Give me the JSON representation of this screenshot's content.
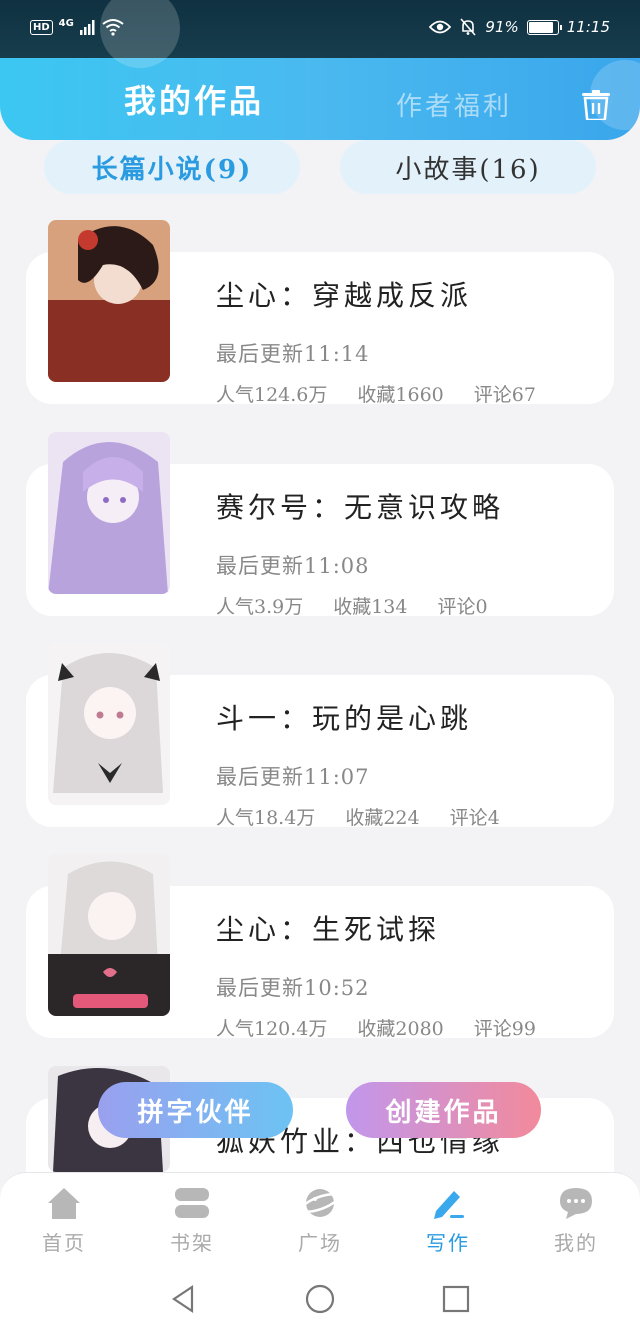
{
  "status_bar": {
    "network_badge": "HD",
    "network_type": "4G",
    "battery_percent": "91%",
    "battery_level": 0.91,
    "time": "11:15"
  },
  "header": {
    "tab_active": "我的作品",
    "tab_inactive": "作者福利",
    "trash_icon": "trash-icon",
    "accent_color": "#3cc7f2"
  },
  "categories": [
    {
      "label": "长篇小说(9)",
      "active": true
    },
    {
      "label": "小故事(16)",
      "active": false
    }
  ],
  "works": [
    {
      "title": "尘心：穿越成反派",
      "update": "最后更新11:14",
      "popularity": "人气124.6万",
      "favorites": "收藏1660",
      "comments": "评论67"
    },
    {
      "title": "赛尔号：无意识攻略",
      "update": "最后更新11:08",
      "popularity": "人气3.9万",
      "favorites": "收藏134",
      "comments": "评论0"
    },
    {
      "title": "斗一：玩的是心跳",
      "update": "最后更新11:07",
      "popularity": "人气18.4万",
      "favorites": "收藏224",
      "comments": "评论4"
    },
    {
      "title": "尘心：生死试探",
      "update": "最后更新10:52",
      "popularity": "人气120.4万",
      "favorites": "收藏2080",
      "comments": "评论99"
    },
    {
      "title": "狐妖竹业：西也情缘",
      "update": "",
      "popularity": "",
      "favorites": "",
      "comments": ""
    }
  ],
  "floating_buttons": {
    "partner": "拼字伙伴",
    "create": "创建作品"
  },
  "bottom_nav": [
    {
      "label": "首页",
      "icon": "home-icon",
      "active": false
    },
    {
      "label": "书架",
      "icon": "bookshelf-icon",
      "active": false
    },
    {
      "label": "广场",
      "icon": "planet-icon",
      "active": false
    },
    {
      "label": "写作",
      "icon": "pen-icon",
      "active": true
    },
    {
      "label": "我的",
      "icon": "chat-bubble-icon",
      "active": false
    }
  ],
  "system_nav": [
    "back-icon",
    "home-circle-icon",
    "recents-square-icon"
  ]
}
